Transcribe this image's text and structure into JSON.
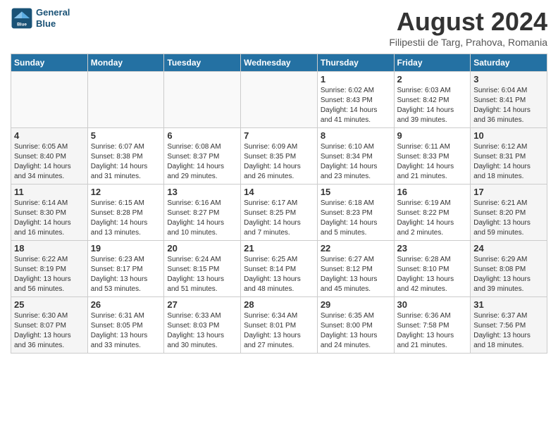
{
  "header": {
    "logo_line1": "General",
    "logo_line2": "Blue",
    "title": "August 2024",
    "subtitle": "Filipestii de Targ, Prahova, Romania"
  },
  "columns": [
    "Sunday",
    "Monday",
    "Tuesday",
    "Wednesday",
    "Thursday",
    "Friday",
    "Saturday"
  ],
  "weeks": [
    [
      {
        "day": "",
        "info": ""
      },
      {
        "day": "",
        "info": ""
      },
      {
        "day": "",
        "info": ""
      },
      {
        "day": "",
        "info": ""
      },
      {
        "day": "1",
        "info": "Sunrise: 6:02 AM\nSunset: 8:43 PM\nDaylight: 14 hours\nand 41 minutes."
      },
      {
        "day": "2",
        "info": "Sunrise: 6:03 AM\nSunset: 8:42 PM\nDaylight: 14 hours\nand 39 minutes."
      },
      {
        "day": "3",
        "info": "Sunrise: 6:04 AM\nSunset: 8:41 PM\nDaylight: 14 hours\nand 36 minutes."
      }
    ],
    [
      {
        "day": "4",
        "info": "Sunrise: 6:05 AM\nSunset: 8:40 PM\nDaylight: 14 hours\nand 34 minutes."
      },
      {
        "day": "5",
        "info": "Sunrise: 6:07 AM\nSunset: 8:38 PM\nDaylight: 14 hours\nand 31 minutes."
      },
      {
        "day": "6",
        "info": "Sunrise: 6:08 AM\nSunset: 8:37 PM\nDaylight: 14 hours\nand 29 minutes."
      },
      {
        "day": "7",
        "info": "Sunrise: 6:09 AM\nSunset: 8:35 PM\nDaylight: 14 hours\nand 26 minutes."
      },
      {
        "day": "8",
        "info": "Sunrise: 6:10 AM\nSunset: 8:34 PM\nDaylight: 14 hours\nand 23 minutes."
      },
      {
        "day": "9",
        "info": "Sunrise: 6:11 AM\nSunset: 8:33 PM\nDaylight: 14 hours\nand 21 minutes."
      },
      {
        "day": "10",
        "info": "Sunrise: 6:12 AM\nSunset: 8:31 PM\nDaylight: 14 hours\nand 18 minutes."
      }
    ],
    [
      {
        "day": "11",
        "info": "Sunrise: 6:14 AM\nSunset: 8:30 PM\nDaylight: 14 hours\nand 16 minutes."
      },
      {
        "day": "12",
        "info": "Sunrise: 6:15 AM\nSunset: 8:28 PM\nDaylight: 14 hours\nand 13 minutes."
      },
      {
        "day": "13",
        "info": "Sunrise: 6:16 AM\nSunset: 8:27 PM\nDaylight: 14 hours\nand 10 minutes."
      },
      {
        "day": "14",
        "info": "Sunrise: 6:17 AM\nSunset: 8:25 PM\nDaylight: 14 hours\nand 7 minutes."
      },
      {
        "day": "15",
        "info": "Sunrise: 6:18 AM\nSunset: 8:23 PM\nDaylight: 14 hours\nand 5 minutes."
      },
      {
        "day": "16",
        "info": "Sunrise: 6:19 AM\nSunset: 8:22 PM\nDaylight: 14 hours\nand 2 minutes."
      },
      {
        "day": "17",
        "info": "Sunrise: 6:21 AM\nSunset: 8:20 PM\nDaylight: 13 hours\nand 59 minutes."
      }
    ],
    [
      {
        "day": "18",
        "info": "Sunrise: 6:22 AM\nSunset: 8:19 PM\nDaylight: 13 hours\nand 56 minutes."
      },
      {
        "day": "19",
        "info": "Sunrise: 6:23 AM\nSunset: 8:17 PM\nDaylight: 13 hours\nand 53 minutes."
      },
      {
        "day": "20",
        "info": "Sunrise: 6:24 AM\nSunset: 8:15 PM\nDaylight: 13 hours\nand 51 minutes."
      },
      {
        "day": "21",
        "info": "Sunrise: 6:25 AM\nSunset: 8:14 PM\nDaylight: 13 hours\nand 48 minutes."
      },
      {
        "day": "22",
        "info": "Sunrise: 6:27 AM\nSunset: 8:12 PM\nDaylight: 13 hours\nand 45 minutes."
      },
      {
        "day": "23",
        "info": "Sunrise: 6:28 AM\nSunset: 8:10 PM\nDaylight: 13 hours\nand 42 minutes."
      },
      {
        "day": "24",
        "info": "Sunrise: 6:29 AM\nSunset: 8:08 PM\nDaylight: 13 hours\nand 39 minutes."
      }
    ],
    [
      {
        "day": "25",
        "info": "Sunrise: 6:30 AM\nSunset: 8:07 PM\nDaylight: 13 hours\nand 36 minutes."
      },
      {
        "day": "26",
        "info": "Sunrise: 6:31 AM\nSunset: 8:05 PM\nDaylight: 13 hours\nand 33 minutes."
      },
      {
        "day": "27",
        "info": "Sunrise: 6:33 AM\nSunset: 8:03 PM\nDaylight: 13 hours\nand 30 minutes."
      },
      {
        "day": "28",
        "info": "Sunrise: 6:34 AM\nSunset: 8:01 PM\nDaylight: 13 hours\nand 27 minutes."
      },
      {
        "day": "29",
        "info": "Sunrise: 6:35 AM\nSunset: 8:00 PM\nDaylight: 13 hours\nand 24 minutes."
      },
      {
        "day": "30",
        "info": "Sunrise: 6:36 AM\nSunset: 7:58 PM\nDaylight: 13 hours\nand 21 minutes."
      },
      {
        "day": "31",
        "info": "Sunrise: 6:37 AM\nSunset: 7:56 PM\nDaylight: 13 hours\nand 18 minutes."
      }
    ]
  ]
}
